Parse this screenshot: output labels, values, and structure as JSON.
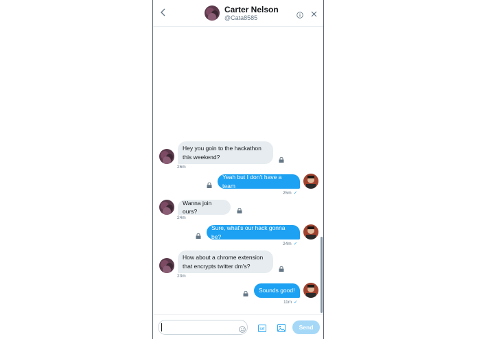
{
  "header": {
    "name": "Carter Nelson",
    "handle": "@Cata8585",
    "back_icon": "chevron-left-icon",
    "info_icon": "info-icon",
    "close_icon": "close-icon"
  },
  "messages": [
    {
      "direction": "in",
      "lines": [
        "Hey you goin to the hackathon",
        "this weekend?"
      ],
      "time": "26m",
      "icon": "lock-icon"
    },
    {
      "direction": "out",
      "lines": [
        "Yeah but I don't have a team"
      ],
      "time": "25m",
      "icon": "lock-icon"
    },
    {
      "direction": "in",
      "lines": [
        "Wanna join ours?"
      ],
      "time": "24m",
      "icon": "lock-icon"
    },
    {
      "direction": "out",
      "lines": [
        "Sure, what's our hack gonna be?"
      ],
      "time": "24m",
      "icon": "lock-icon"
    },
    {
      "direction": "in",
      "lines": [
        "How about a chrome extension",
        "that encrypts twitter dm's?"
      ],
      "time": "23m",
      "icon": "lock-icon"
    },
    {
      "direction": "out",
      "lines": [
        "Sounds good!"
      ],
      "time": "11m",
      "icon": "lock-icon"
    }
  ],
  "composer": {
    "input_value": "",
    "gif_label": "GIF",
    "send_label": "Send",
    "emoji_icon": "emoji-icon",
    "media_icon": "image-icon"
  },
  "colors": {
    "accent": "#1da1f2",
    "incoming_bubble": "#e6ecf0",
    "send_disabled": "#a5d8f7",
    "muted_text": "#657786"
  }
}
